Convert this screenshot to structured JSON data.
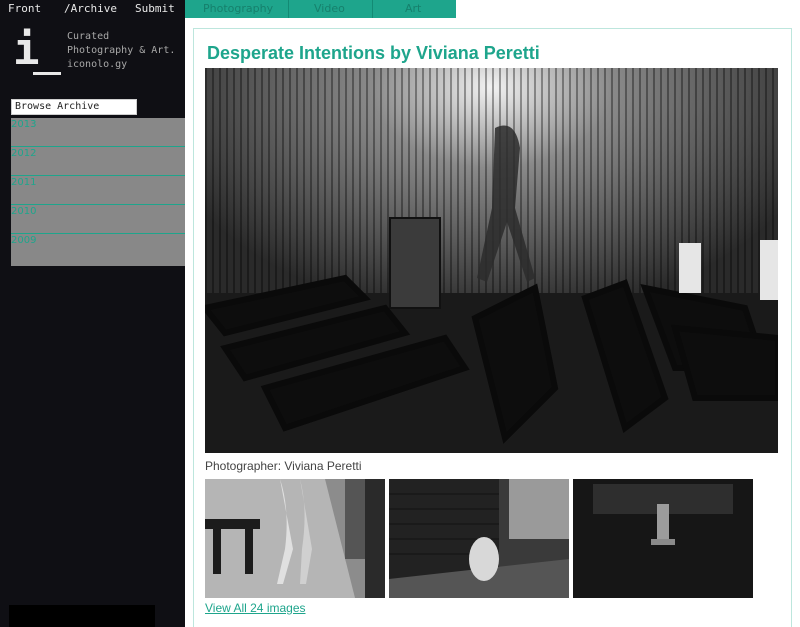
{
  "nav": {
    "front": "Front",
    "archive": "/Archive",
    "submit": "Submit",
    "photography": "Photography",
    "video": "Video",
    "art": "Art"
  },
  "logo": {
    "mark": "i"
  },
  "tagline": {
    "line1": "Curated",
    "line2": "Photography & Art.",
    "line3": "iconolo.gy"
  },
  "sidebar": {
    "archive_label": "Browse Archive",
    "years": [
      "2013",
      "2012",
      "2011",
      "2010",
      "2009"
    ]
  },
  "post": {
    "title": "Desperate Intentions by Viviana Peretti",
    "caption": "Photographer: Viviana Peretti",
    "view_all": "View All 24 images"
  },
  "colors": {
    "accent": "#1ea58c",
    "sidebar_bg": "#0f0f14",
    "archive_panel": "#888888"
  }
}
